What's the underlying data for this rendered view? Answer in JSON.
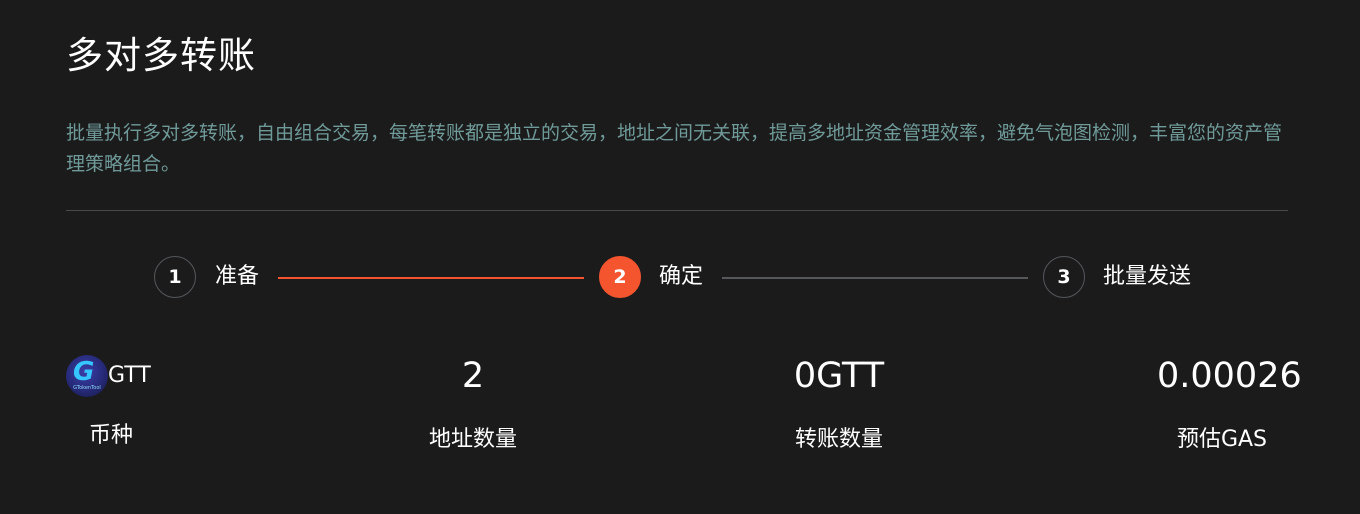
{
  "header": {
    "title": "多对多转账",
    "description": "批量执行多对多转账，自由组合交易，每笔转账都是独立的交易，地址之间无关联，提高多地址资金管理效率，避免气泡图检测，丰富您的资产管理策略组合。"
  },
  "steps": [
    {
      "number": "1",
      "label": "准备",
      "state": "done"
    },
    {
      "number": "2",
      "label": "确定",
      "state": "active"
    },
    {
      "number": "3",
      "label": "批量发送",
      "state": "pending"
    }
  ],
  "colors": {
    "accent": "#f4552e",
    "description_text": "#6f9a98",
    "background": "#1b1b1c"
  },
  "stats": {
    "coin": {
      "icon": "gtoken-logo-icon",
      "logo_text": "GTokenTool",
      "value": "GTT",
      "label": "币种"
    },
    "address_count": {
      "value": "2",
      "label": "地址数量"
    },
    "transfer_amount": {
      "value": "0GTT",
      "label": "转账数量"
    },
    "estimated_gas": {
      "value": "0.00026",
      "label": "预估GAS"
    }
  }
}
